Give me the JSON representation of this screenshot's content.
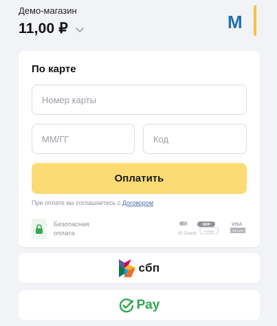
{
  "header": {
    "shop_name": "Демо-магазин",
    "amount": "11,00 ₽"
  },
  "logo": {
    "letter": "M",
    "colors": {
      "letter": "#1f6fb0",
      "bar": "#f5c243"
    }
  },
  "card_form": {
    "title": "По карте",
    "card_number_placeholder": "Номер карты",
    "expiry_placeholder": "ММ/ГГ",
    "cvc_placeholder": "Код",
    "pay_label": "Оплатить",
    "agree_text": "При оплате вы соглашаетесь с ",
    "agree_link": "Договором",
    "secure_line1": "Безопасная",
    "secure_line2": "оплата",
    "brands": {
      "idcheck": "ID Check",
      "mir": "МИР",
      "mir_sub": "Accept",
      "visa": "VISA",
      "visa_sub": "SECURE"
    }
  },
  "alt_methods": {
    "sbp_label": "сбп",
    "pay_label": "Pay"
  },
  "colors": {
    "accent": "#fcdb75",
    "link": "#4a6fa8",
    "green": "#2fa84f",
    "background": "#f2f3f7"
  },
  "icons": [
    "chevron-down-icon",
    "lock-icon",
    "sbp-logo-icon",
    "checkmark-circle-icon"
  ]
}
